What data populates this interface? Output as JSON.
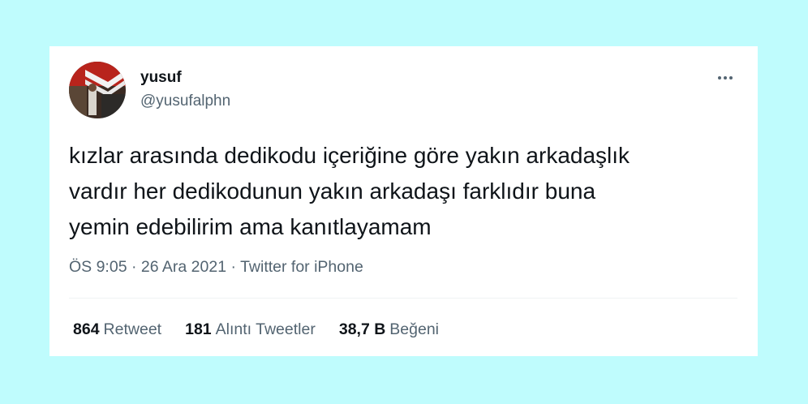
{
  "user": {
    "display_name": "yusuf",
    "handle": "@yusufalphn"
  },
  "tweet": {
    "lines": [
      "kızlar arasında dedikodu içeriğine göre yakın arkadaşlık",
      "vardır her dedikodunun yakın arkadaşı farklıdır buna",
      "yemin edebilirim ama kanıtlayamam"
    ],
    "time": "ÖS 9:05",
    "separator": " · ",
    "date": "26 Ara 2021",
    "source": "Twitter for iPhone"
  },
  "stats": [
    {
      "count": "864",
      "label": "Retweet"
    },
    {
      "count": "181",
      "label": "Alıntı Tweetler"
    },
    {
      "count": "38,7 B",
      "label": "Beğeni"
    }
  ],
  "icons": {
    "more": "more-horizontal-icon"
  },
  "colors": {
    "background": "#bffcfd",
    "card": "#ffffff",
    "text_primary": "#0f1419",
    "text_secondary": "#536471"
  }
}
